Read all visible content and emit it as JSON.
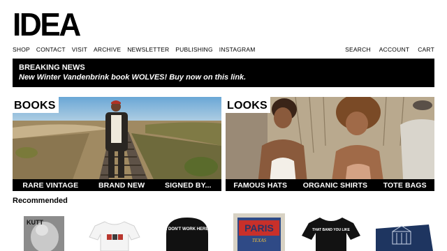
{
  "brand": {
    "logo": "IDEA"
  },
  "nav": {
    "left": [
      "SHOP",
      "CONTACT",
      "VISIT",
      "ARCHIVE",
      "NEWSLETTER",
      "PUBLISHING",
      "INSTAGRAM"
    ],
    "right": [
      "SEARCH",
      "ACCOUNT",
      "CART"
    ]
  },
  "banner": {
    "title": "BREAKING NEWS",
    "text": "New Winter Vandenbrink book WOLVES! Buy now on this link."
  },
  "panels": {
    "books": {
      "label": "BOOKS",
      "links": [
        "RARE VINTAGE",
        "BRAND NEW",
        "SIGNED BY..."
      ]
    },
    "looks": {
      "label": "LOOKS",
      "links": [
        "FAMOUS HATS",
        "ORGANIC SHIRTS",
        "TOTE BAGS"
      ]
    }
  },
  "recommended": {
    "title": "Recommended",
    "items": [
      {
        "name": "kutt-book-icon",
        "cover_text": "KUTT"
      },
      {
        "name": "white-tshirt-icon"
      },
      {
        "name": "black-cap-icon",
        "print": "I DON'T WORK HERE"
      },
      {
        "name": "paris-print-icon",
        "print": "PARIS",
        "sub": "TEXAS"
      },
      {
        "name": "black-tshirt-icon",
        "print": "THAT BAND YOU LIKE"
      },
      {
        "name": "navy-book-icon"
      }
    ]
  },
  "colors": {
    "banner_bg": "#000000",
    "banner_text": "#ffffff",
    "page_bg": "#ffffff"
  }
}
